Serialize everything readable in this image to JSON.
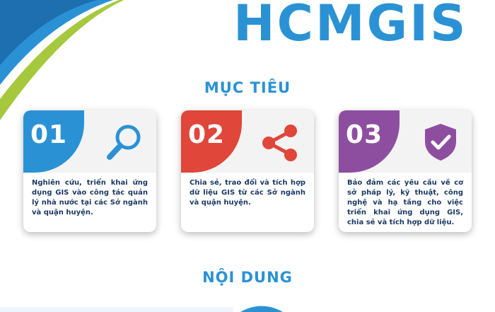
{
  "brand": {
    "title": "HCMGIS"
  },
  "sections": {
    "goals_heading": "MỤC TIÊU",
    "content_heading": "NỘI DUNG"
  },
  "cards": [
    {
      "number": "01",
      "icon": "search-icon",
      "color": "#2a92d4",
      "text": "Nghiên cứu, triển khai ứng dụng GIS vào công tác quản lý nhà nước tại các Sở ngành và quận huyện."
    },
    {
      "number": "02",
      "icon": "share-icon",
      "color": "#e0463a",
      "text": "Chia sẻ, trao đổi và tích hợp dữ liệu GIS từ các Sở ngành và quận huyện."
    },
    {
      "number": "03",
      "icon": "shield-check-icon",
      "color": "#8e4ea0",
      "text": "Bảo đảm các yêu cầu về cơ sở pháp lý, kỹ thuật, công nghệ và hạ tầng cho việc triển khai ứng dụng GIS, chia sẻ và tích hợp dữ liệu."
    }
  ],
  "colors": {
    "brand_blue": "#2a92d4",
    "text_navy": "#1c3a64",
    "corner_green": "#a6c83c",
    "card_shadow": "#cccccc"
  }
}
